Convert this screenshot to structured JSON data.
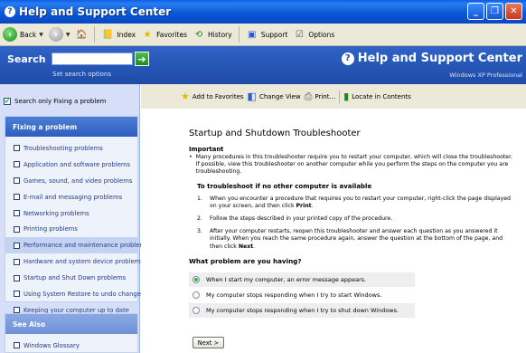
{
  "window": {
    "title": "Help and Support Center"
  },
  "toolbar": {
    "back": "Back",
    "index": "Index",
    "favorites": "Favorites",
    "history": "History",
    "support": "Support",
    "options": "Options"
  },
  "header": {
    "search_label": "Search",
    "search_value": "",
    "search_options": "Set search options",
    "title": "Help and Support Center",
    "subtitle": "Windows XP Professional"
  },
  "sidebar": {
    "only_fixing": "Search only Fixing a problem",
    "panel_title": "Fixing a problem",
    "items": [
      "Troubleshooting problems",
      "Application and software problems",
      "Games, sound, and video problems",
      "E-mail and messaging problems",
      "Networking problems",
      "Printing problems",
      "Performance and maintenance problems",
      "Hardware and system device problems",
      "Startup and Shut Down problems",
      "Using System Restore to undo changes",
      "Keeping your computer up to date"
    ],
    "see_also_title": "See Also",
    "see_also_items": [
      "Windows Glossary"
    ]
  },
  "actions": {
    "add_favorites": "Add to Favorites",
    "change_view": "Change View",
    "print": "Print...",
    "locate": "Locate in Contents"
  },
  "article": {
    "title": "Startup and Shutdown Troubleshooter",
    "important_label": "Important",
    "important_text": "Many procedures in this troubleshooter require you to restart your computer, which will close the troubleshooter. If possible, view this troubleshooter on another computer while you perform the steps on the computer you are troubleshooting.",
    "to_troubleshoot": "To troubleshoot if no other computer is available",
    "steps": [
      {
        "num": "1.",
        "pre": "When you encounter a procedure that requires you to restart your computer, right-click the page displayed on your screen, and then click ",
        "bold": "Print",
        "post": "."
      },
      {
        "num": "2.",
        "pre": "Follow the steps described in your printed copy of the procedure.",
        "bold": "",
        "post": ""
      },
      {
        "num": "3.",
        "pre": "After your computer restarts, reopen this troubleshooter and answer each question as you answered it initially. When you reach the same procedure again, answer the question at the bottom of the page, and then click ",
        "bold": "Next",
        "post": "."
      }
    ],
    "question": "What problem are you having?",
    "answers": [
      "When I start my computer, an error message appears.",
      "My computer stops responding when I try to start Windows.",
      "My computer stops responding when I try to shut down Windows."
    ],
    "selected_answer": 0,
    "next_label": "Next  >"
  }
}
